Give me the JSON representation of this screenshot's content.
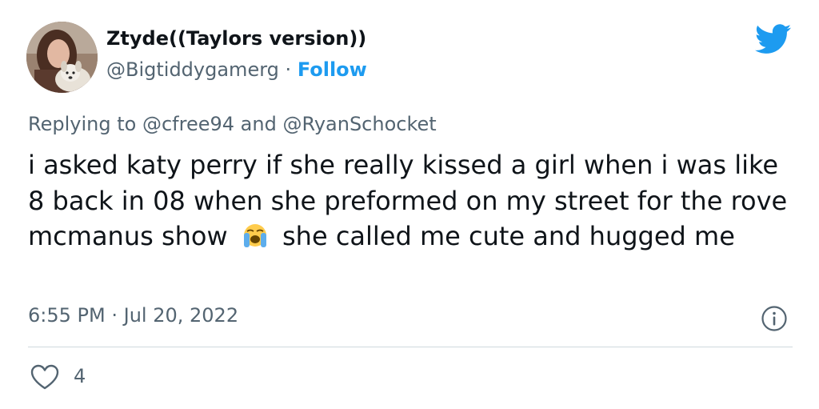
{
  "tweet": {
    "display_name": "Ztyde((Taylors version))",
    "handle": "@Bigtiddygamerg",
    "separator": "·",
    "follow_label": "Follow",
    "reply_prefix": "Replying to",
    "reply_mention_1": "@cfree94",
    "reply_and": "and",
    "reply_mention_2": "@RyanSchocket",
    "text_part1": "i asked katy perry if she really kissed a girl when i was like 8 back in 08 when she preformed on my street for the rove mcmanus show",
    "text_part2": "she called me cute and hugged me",
    "time": "6:55 PM",
    "date": "Jul 20, 2022",
    "like_count": "4"
  },
  "icons": {
    "brand": "twitter-bird-icon",
    "emoji": "loudly-crying-face-emoji",
    "info": "info-icon",
    "like": "heart-icon"
  },
  "colors": {
    "brand_blue": "#1d9bf0",
    "text_primary": "#0f1419",
    "text_secondary": "#536471",
    "divider": "#cfd9de"
  }
}
